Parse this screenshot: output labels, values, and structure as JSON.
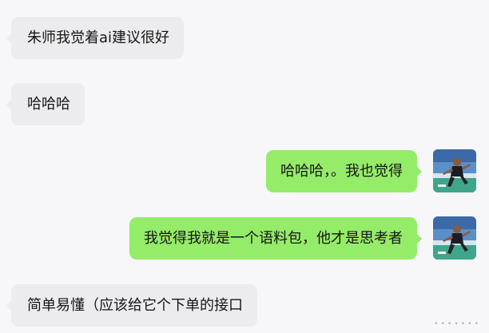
{
  "messages": [
    {
      "id": 1,
      "side": "incoming",
      "text": "朱师我觉着ai建议很好"
    },
    {
      "id": 2,
      "side": "incoming",
      "text": "哈哈哈"
    },
    {
      "id": 3,
      "side": "outgoing",
      "text": "哈哈哈，。我也觉得"
    },
    {
      "id": 4,
      "side": "outgoing",
      "text": "我觉得我就是一个语料包，他才是思考者"
    },
    {
      "id": 5,
      "side": "incoming",
      "text": "简单易懂（应该给它个下单的接口"
    }
  ],
  "colors": {
    "background": "#f7f7f9",
    "incoming_bubble": "#ececef",
    "outgoing_bubble": "#95ec69"
  },
  "icons": {
    "more": "more-dots-icon",
    "avatar": "user-avatar-photo"
  },
  "scroll_hint": "•••••••"
}
